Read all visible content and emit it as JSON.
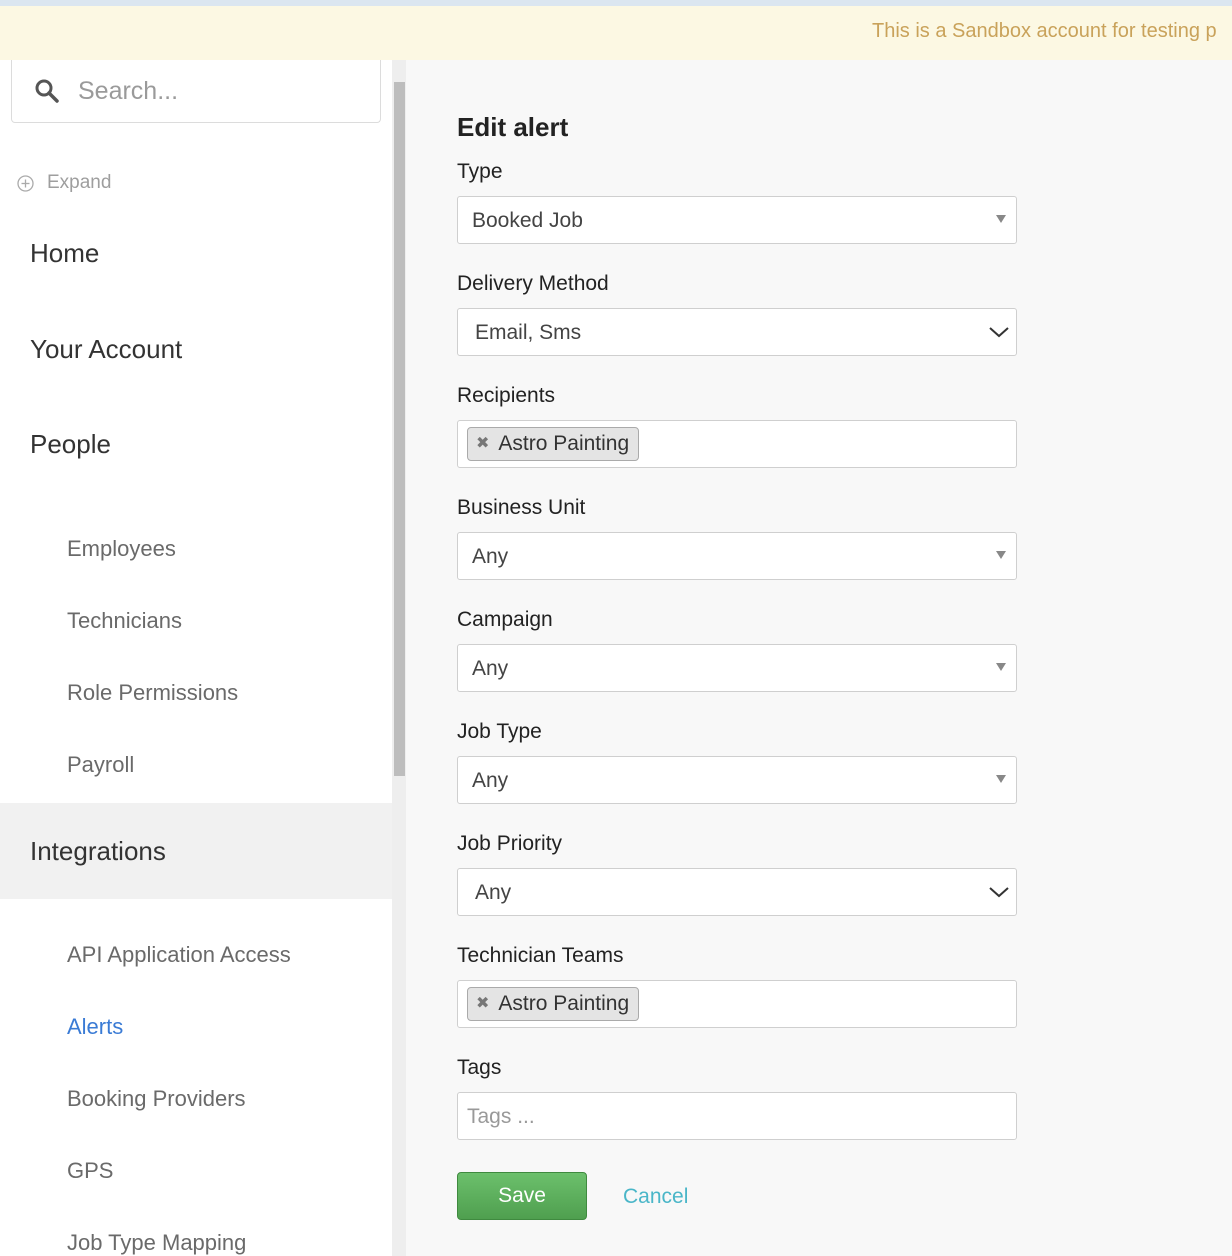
{
  "banner": {
    "text": "This is a Sandbox account for testing p"
  },
  "sidebar": {
    "search_placeholder": "Search...",
    "expand_label": "Expand",
    "items": [
      {
        "label": "Home"
      },
      {
        "label": "Your Account"
      },
      {
        "label": "People"
      },
      {
        "label": "Employees"
      },
      {
        "label": "Technicians"
      },
      {
        "label": "Role Permissions"
      },
      {
        "label": "Payroll"
      },
      {
        "label": "Integrations"
      },
      {
        "label": "API Application Access"
      },
      {
        "label": "Alerts"
      },
      {
        "label": "Booking Providers"
      },
      {
        "label": "GPS"
      },
      {
        "label": "Job Type Mapping"
      }
    ]
  },
  "form": {
    "title": "Edit alert",
    "type": {
      "label": "Type",
      "value": "Booked Job"
    },
    "delivery": {
      "label": "Delivery Method",
      "value": "Email, Sms"
    },
    "recipients": {
      "label": "Recipients",
      "chips": [
        "Astro Painting"
      ]
    },
    "business_unit": {
      "label": "Business Unit",
      "value": "Any"
    },
    "campaign": {
      "label": "Campaign",
      "value": "Any"
    },
    "job_type": {
      "label": "Job Type",
      "value": "Any"
    },
    "job_priority": {
      "label": "Job Priority",
      "value": "Any"
    },
    "technician_teams": {
      "label": "Technician Teams",
      "chips": [
        "Astro Painting"
      ]
    },
    "tags": {
      "label": "Tags",
      "placeholder": "Tags ..."
    },
    "save_label": "Save",
    "cancel_label": "Cancel"
  },
  "colors": {
    "banner_bg": "#fcf8e3",
    "banner_text": "#c9a25a",
    "active_link": "#3a7bd5",
    "save_button": "#5cb85c",
    "cancel_link": "#4ab6c8"
  }
}
